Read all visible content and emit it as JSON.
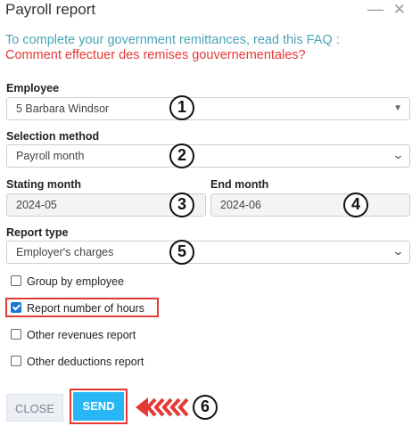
{
  "header": {
    "title": "Payroll report",
    "minimize_glyph": "—",
    "close_glyph": "✕"
  },
  "info": {
    "line1": "To complete your government remittances, read this FAQ :",
    "line2": "Comment effectuer des remises gouvernementales?"
  },
  "employee": {
    "label": "Employee",
    "value": "5 Barbara Windsor",
    "marker": "1"
  },
  "selection_method": {
    "label": "Selection method",
    "value": "Payroll month",
    "marker": "2"
  },
  "starting_month": {
    "label": "Stating month",
    "value": "2024-05",
    "marker": "3"
  },
  "end_month": {
    "label": "End month",
    "value": "2024-06",
    "marker": "4"
  },
  "report_type": {
    "label": "Report type",
    "value": "Employer's charges",
    "marker": "5"
  },
  "options": [
    {
      "label": "Group by employee",
      "checked": false
    },
    {
      "label": "Report number of hours",
      "checked": true
    },
    {
      "label": "Other revenues report",
      "checked": false
    },
    {
      "label": "Other deductions report",
      "checked": false
    }
  ],
  "buttons": {
    "close": "CLOSE",
    "send": "SEND"
  },
  "annotation": {
    "arrow": "⟪⟪⟪",
    "marker": "6"
  },
  "colors": {
    "accent_blue": "#29b6f6",
    "info_teal": "#4aa3b8",
    "highlight_red": "#e53935"
  }
}
